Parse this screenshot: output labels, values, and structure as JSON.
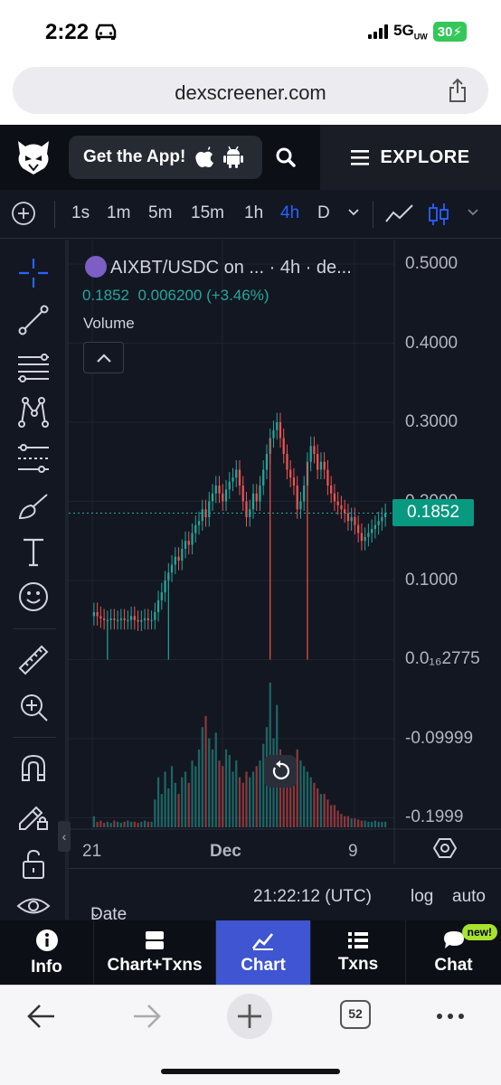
{
  "status_bar": {
    "time": "2:22",
    "network": "5G",
    "network_sup": "UW",
    "battery": "30"
  },
  "browser": {
    "url": "dexscreener.com",
    "tab_count": "52"
  },
  "header": {
    "get_app": "Get the App!",
    "explore": "EXPLORE"
  },
  "timeframes": {
    "items": [
      "1s",
      "1m",
      "5m",
      "15m",
      "1h",
      "4h",
      "D"
    ],
    "active": "4h"
  },
  "legend": {
    "title": "AIXBT/USDC on ... · 4h · de...",
    "price": "0.1852",
    "change": "0.006200 (+3.46%)",
    "volume_label": "Volume"
  },
  "price_axis": {
    "labels": [
      "0.5000",
      "0.4000",
      "0.3000",
      "0.2000",
      "0.1000",
      "0.0₁₆2775",
      "-0.09999",
      "-0.1999"
    ],
    "current_price": "0.1852"
  },
  "time_axis": {
    "labels": [
      "21",
      "Dec",
      "9"
    ]
  },
  "range_bar": {
    "date_range": "Date Range",
    "time": "21:22:12 (UTC)",
    "log": "log",
    "auto": "auto"
  },
  "bottom_nav": {
    "items": [
      {
        "label": "Info",
        "icon": "info-icon"
      },
      {
        "label": "Chart+Txns",
        "icon": "split-view-icon"
      },
      {
        "label": "Chart",
        "icon": "chart-icon"
      },
      {
        "label": "Txns",
        "icon": "list-icon"
      },
      {
        "label": "Chat",
        "icon": "chat-icon"
      }
    ],
    "active": "Chart",
    "chat_badge": "new!"
  },
  "colors": {
    "up": "#26a69a",
    "down": "#ef5350",
    "accent": "#2962ff",
    "nav_active": "#3f55d1",
    "background": "#131722"
  },
  "chart_data": {
    "type": "candlestick",
    "title": "AIXBT/USDC · 4h",
    "x_ticks": [
      "21",
      "Dec",
      "9"
    ],
    "ylim": [
      -0.25,
      0.55
    ],
    "y_ticks": [
      0.5,
      0.4,
      0.3,
      0.2,
      0.1,
      0.0,
      -0.09999,
      -0.1999
    ],
    "last_price": 0.1852,
    "close_series": [
      0.06,
      0.055,
      0.052,
      0.05,
      0.05,
      0.052,
      0.05,
      0.05,
      0.052,
      0.05,
      0.05,
      0.055,
      0.05,
      0.048,
      0.05,
      0.052,
      0.05,
      0.05,
      0.06,
      0.075,
      0.085,
      0.1,
      0.11,
      0.12,
      0.13,
      0.125,
      0.14,
      0.15,
      0.145,
      0.16,
      0.17,
      0.175,
      0.19,
      0.18,
      0.2,
      0.21,
      0.22,
      0.21,
      0.2,
      0.215,
      0.225,
      0.23,
      0.24,
      0.22,
      0.2,
      0.18,
      0.19,
      0.21,
      0.2,
      0.22,
      0.24,
      0.26,
      0.28,
      0.29,
      0.3,
      0.28,
      0.26,
      0.24,
      0.23,
      0.22,
      0.19,
      0.2,
      0.22,
      0.25,
      0.27,
      0.26,
      0.24,
      0.25,
      0.24,
      0.22,
      0.21,
      0.2,
      0.195,
      0.19,
      0.185,
      0.175,
      0.18,
      0.17,
      0.16,
      0.15,
      0.155,
      0.16,
      0.165,
      0.17,
      0.175,
      0.18,
      0.1852
    ],
    "volume_series": [
      0.1,
      0.05,
      0.06,
      0.04,
      0.05,
      0.04,
      0.06,
      0.05,
      0.04,
      0.05,
      0.06,
      0.05,
      0.05,
      0.04,
      0.05,
      0.06,
      0.05,
      0.05,
      0.25,
      0.45,
      0.3,
      0.5,
      0.35,
      0.55,
      0.4,
      0.3,
      0.45,
      0.5,
      0.4,
      0.6,
      0.55,
      0.7,
      0.9,
      1.0,
      0.8,
      0.7,
      0.85,
      0.6,
      0.55,
      0.7,
      0.65,
      0.5,
      0.6,
      0.45,
      0.4,
      0.5,
      0.45,
      0.5,
      0.55,
      0.6,
      0.75,
      0.9,
      1.3,
      0.8,
      1.1,
      0.7,
      0.6,
      0.55,
      0.5,
      0.45,
      0.7,
      0.6,
      0.55,
      0.5,
      0.45,
      0.4,
      0.35,
      0.3,
      0.3,
      0.25,
      0.2,
      0.2,
      0.15,
      0.12,
      0.1,
      0.1,
      0.08,
      0.08,
      0.07,
      0.06,
      0.06,
      0.05,
      0.05,
      0.06,
      0.05,
      0.05,
      0.05
    ]
  }
}
